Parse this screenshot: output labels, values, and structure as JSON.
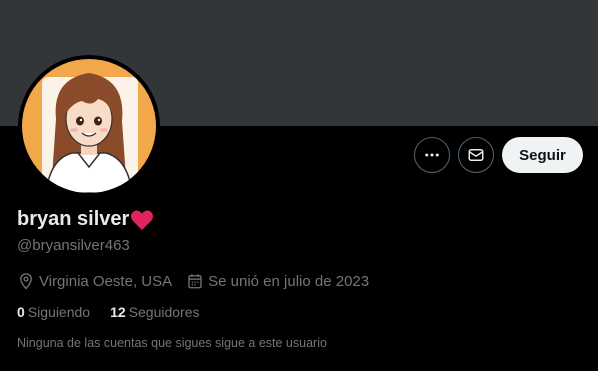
{
  "profile": {
    "display_name": "bryan silver",
    "handle": "@bryansilver463",
    "location": "Virginia Oeste, USA",
    "joined": "Se unió en julio de 2023"
  },
  "actions": {
    "follow_label": "Seguir",
    "more_icon": "more-horizontal-icon",
    "message_icon": "envelope-icon"
  },
  "counts": {
    "following_num": "0",
    "following_label": "Siguiendo",
    "followers_num": "12",
    "followers_label": "Seguidores"
  },
  "note": "Ninguna de las cuentas que sigues sigue a este usuario",
  "colors": {
    "banner": "#333639",
    "background": "#000000",
    "text_primary": "#e7e9ea",
    "text_secondary": "#71767b",
    "follow_button_bg": "#eff3f4",
    "heart": "#e0245e",
    "avatar_bg": "#f2a84a"
  }
}
